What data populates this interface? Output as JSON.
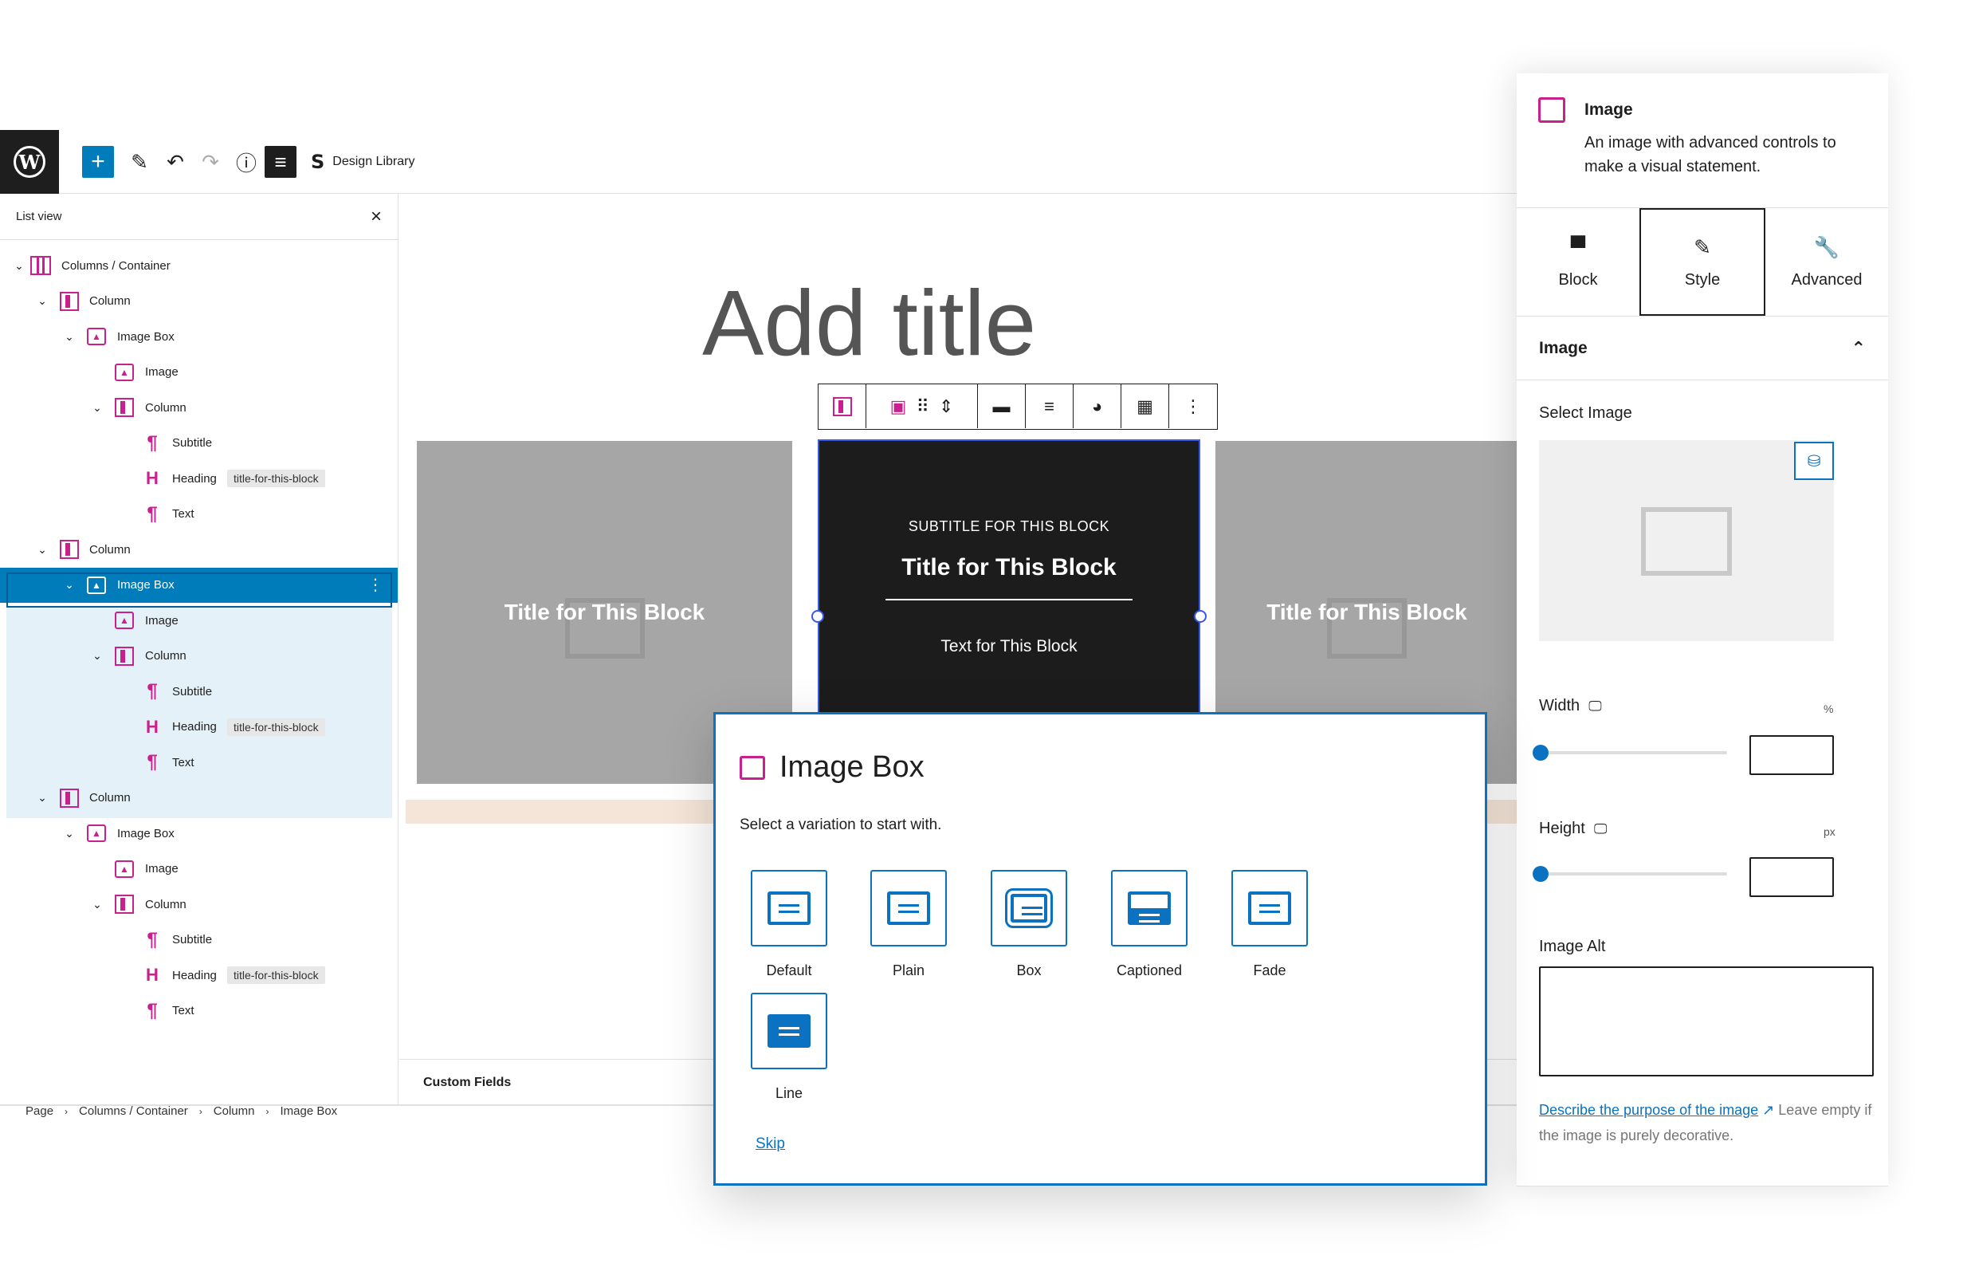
{
  "topbar": {
    "design_library_label": "Design Library"
  },
  "list_view": {
    "title": "List view",
    "items": [
      {
        "label": "Columns / Container",
        "tag": ""
      },
      {
        "label": "Column",
        "tag": ""
      },
      {
        "label": "Image Box",
        "tag": ""
      },
      {
        "label": "Image",
        "tag": ""
      },
      {
        "label": "Column",
        "tag": ""
      },
      {
        "label": "Subtitle",
        "tag": ""
      },
      {
        "label": "Heading",
        "tag": "title-for-this-block"
      },
      {
        "label": "Text",
        "tag": ""
      },
      {
        "label": "Column",
        "tag": ""
      },
      {
        "label": "Image Box",
        "tag": ""
      },
      {
        "label": "Image",
        "tag": ""
      },
      {
        "label": "Column",
        "tag": ""
      },
      {
        "label": "Subtitle",
        "tag": ""
      },
      {
        "label": "Heading",
        "tag": "title-for-this-block"
      },
      {
        "label": "Text",
        "tag": ""
      },
      {
        "label": "Column",
        "tag": ""
      },
      {
        "label": "Image Box",
        "tag": ""
      },
      {
        "label": "Image",
        "tag": ""
      },
      {
        "label": "Column",
        "tag": ""
      },
      {
        "label": "Subtitle",
        "tag": ""
      },
      {
        "label": "Heading",
        "tag": "title-for-this-block"
      },
      {
        "label": "Text",
        "tag": ""
      }
    ]
  },
  "canvas": {
    "page_title_placeholder": "Add title",
    "cards": [
      {
        "title": "Title for This Block"
      },
      {
        "subtitle": "SUBTITLE FOR THIS BLOCK",
        "title": "Title for This Block",
        "text": "Text for This Block"
      },
      {
        "title": "Title for This Block"
      }
    ],
    "custom_fields": "Custom Fields"
  },
  "breadcrumb": [
    "Page",
    "Columns / Container",
    "Column",
    "Image Box"
  ],
  "modal": {
    "title": "Image Box",
    "subtitle": "Select a variation to start with.",
    "variations": [
      "Default",
      "Plain",
      "Box",
      "Captioned",
      "Fade",
      "Line"
    ],
    "skip": "Skip"
  },
  "inspector": {
    "block_title": "Image",
    "block_description": "An image with advanced controls to make a visual statement.",
    "tabs": [
      "Block",
      "Style",
      "Advanced"
    ],
    "active_tab": "Style",
    "panel_title": "Image",
    "select_image_label": "Select Image",
    "width_label": "Width",
    "width_unit": "%",
    "height_label": "Height",
    "height_unit": "px",
    "image_alt_label": "Image Alt",
    "alt_help_link": "Describe the purpose of the image",
    "alt_help_text": "Leave empty if the image is purely decorative."
  },
  "colors": {
    "accent": "#007cba",
    "block_icon": "#c8208c",
    "selection_bg": "#e5f1f8"
  }
}
